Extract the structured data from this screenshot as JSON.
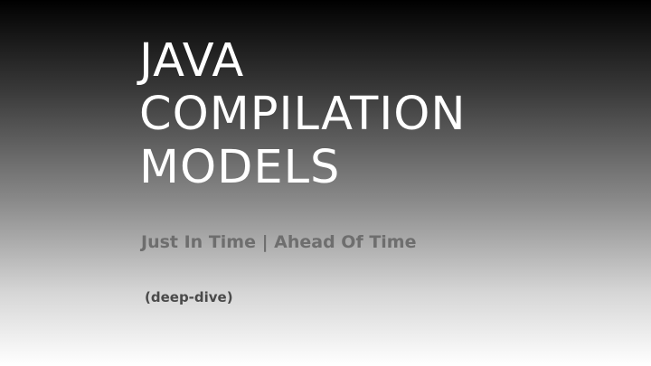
{
  "slide": {
    "title_lines": [
      "JAVA",
      "COMPILATION",
      "MODELS"
    ],
    "subtitle": "Just In Time | Ahead Of Time",
    "note": "(deep-dive)"
  }
}
